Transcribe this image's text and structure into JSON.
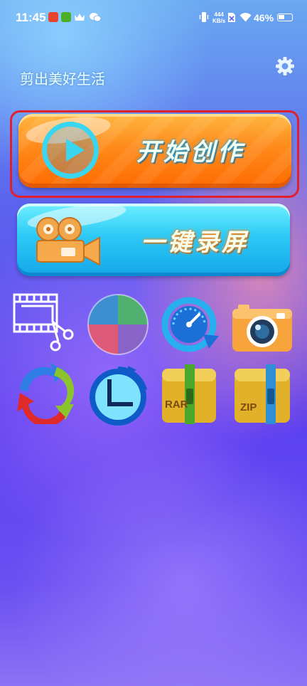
{
  "status_bar": {
    "time": "11:45",
    "net_speed_value": "444",
    "net_speed_unit": "KB/s",
    "battery": "46%"
  },
  "header": {
    "tagline": "剪出美好生活",
    "settings_icon": "gear-icon"
  },
  "main": {
    "create_label": "开始创作",
    "record_label": "一键录屏"
  },
  "tools": [
    {
      "icon": "crop-video-icon"
    },
    {
      "icon": "color-wheel-icon"
    },
    {
      "icon": "speed-gauge-icon"
    },
    {
      "icon": "camera-icon"
    },
    {
      "icon": "convert-arrows-icon"
    },
    {
      "icon": "timer-clock-icon"
    },
    {
      "icon": "rar-archive-icon",
      "label": "RAR"
    },
    {
      "icon": "zip-archive-icon",
      "label": "ZIP"
    }
  ],
  "colors": {
    "create_button": "#ff7a10",
    "record_button": "#2dc9f5",
    "highlight_frame": "#e0202c"
  }
}
